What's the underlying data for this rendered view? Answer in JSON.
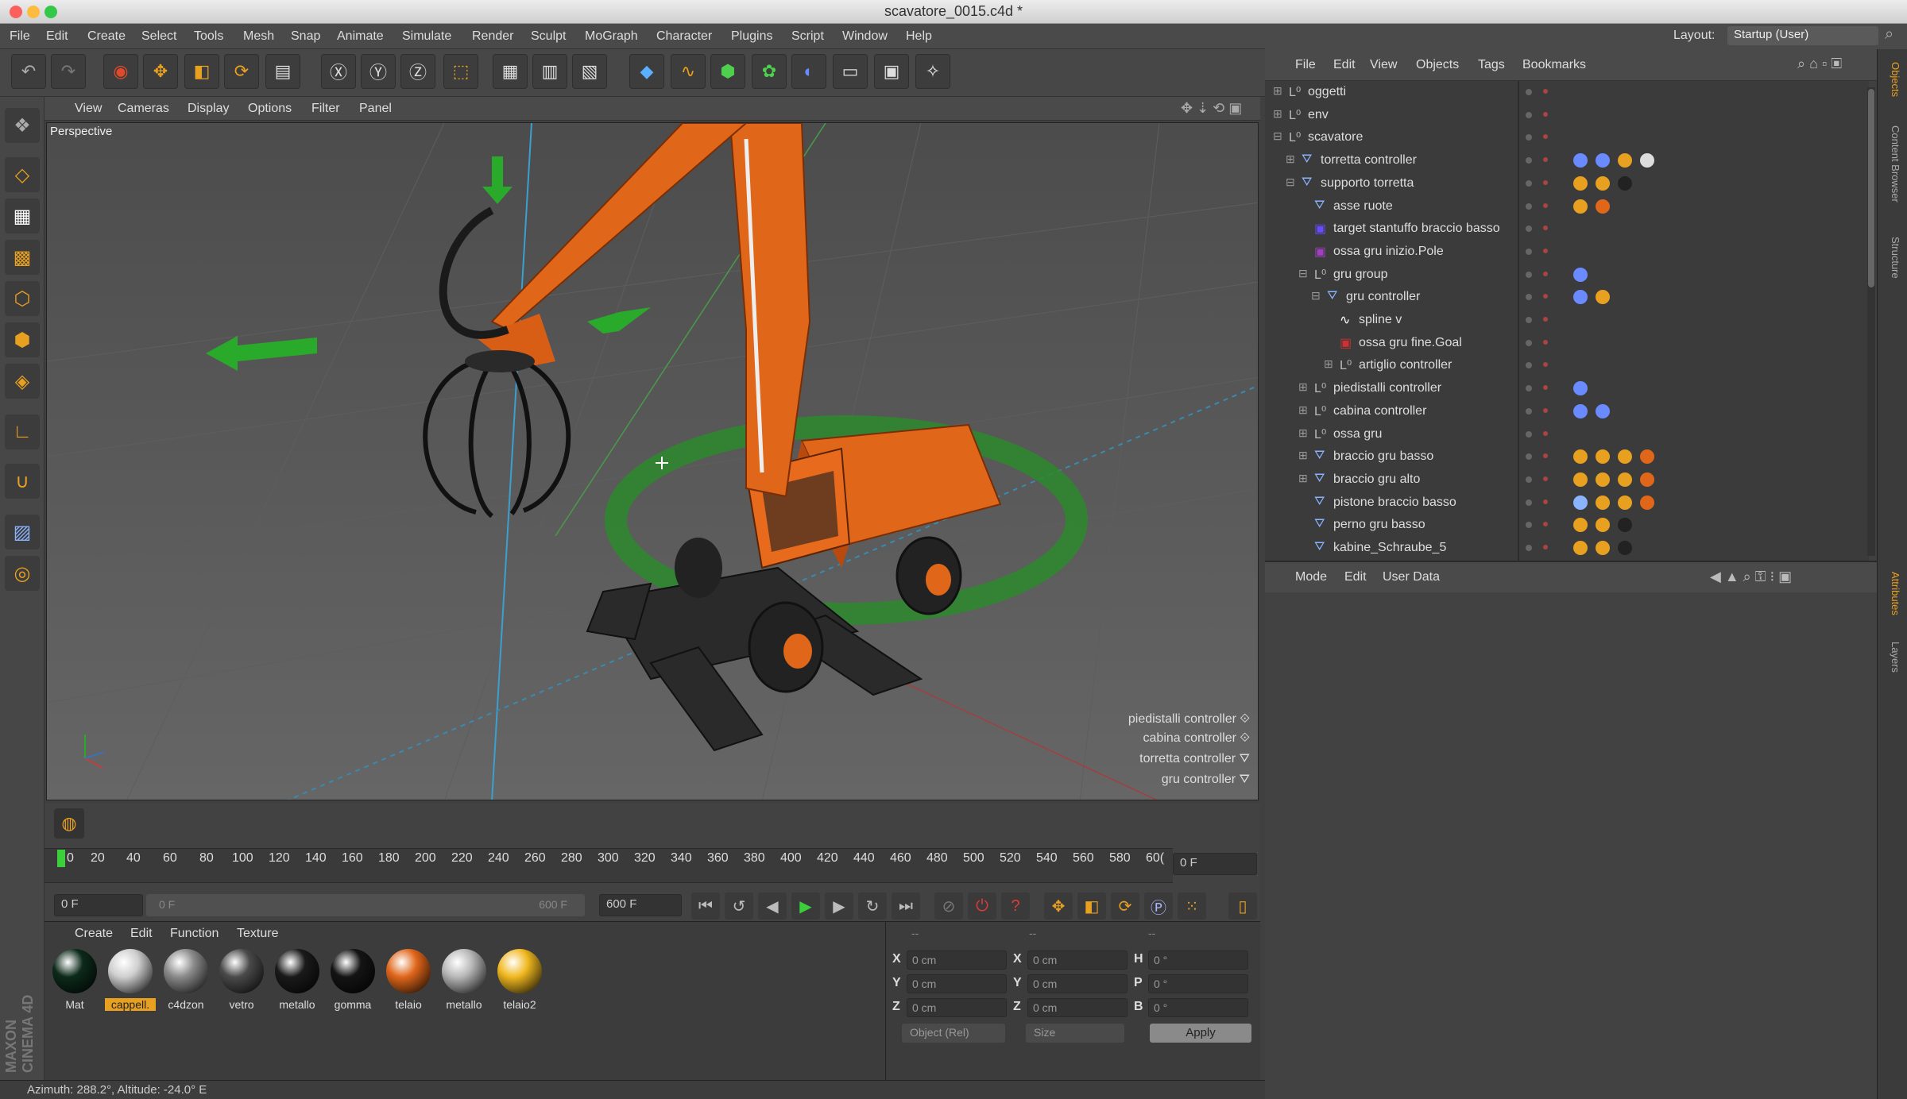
{
  "window": {
    "title": "scavatore_0015.c4d *"
  },
  "menu": [
    "File",
    "Edit",
    "Create",
    "Select",
    "Tools",
    "Mesh",
    "Snap",
    "Animate",
    "Simulate",
    "Render",
    "Sculpt",
    "MoGraph",
    "Character",
    "Plugins",
    "Script",
    "Window",
    "Help"
  ],
  "layout": {
    "label": "Layout:",
    "value": "Startup (User)"
  },
  "viewport_menu": [
    "View",
    "Cameras",
    "Display",
    "Options",
    "Filter",
    "Panel"
  ],
  "viewport": {
    "name": "Perspective",
    "hud": [
      "piedistalli controller",
      "cabina controller",
      "torretta controller",
      "gru controller"
    ]
  },
  "timeline": {
    "ticks": [
      "0",
      "20",
      "40",
      "60",
      "80",
      "100",
      "120",
      "140",
      "160",
      "180",
      "200",
      "220",
      "240",
      "260",
      "280",
      "300",
      "320",
      "340",
      "360",
      "380",
      "400",
      "420",
      "440",
      "460",
      "480",
      "500",
      "520",
      "540",
      "560",
      "580",
      "60("
    ],
    "current_frame": "0 F",
    "start_field": "0 F",
    "slider_start": "0 F",
    "slider_end": "600 F",
    "end_field": "600 F"
  },
  "materials": {
    "menu": [
      "Create",
      "Edit",
      "Function",
      "Texture"
    ],
    "items": [
      {
        "name": "Mat",
        "color": "#0c2a1a"
      },
      {
        "name": "cappell.",
        "color": "#cfcfcf",
        "selected": true
      },
      {
        "name": "c4dzon",
        "color": "#8a8a8a"
      },
      {
        "name": "vetro",
        "color": "#4a4a4a"
      },
      {
        "name": "metallo",
        "color": "#1a1a1a"
      },
      {
        "name": "gomma",
        "color": "#141414"
      },
      {
        "name": "telaio",
        "color": "#e0661a"
      },
      {
        "name": "metallo",
        "color": "#b8b8b8"
      },
      {
        "name": "telaio2",
        "color": "#f0b820"
      }
    ],
    "brand": "MAXON CINEMA 4D"
  },
  "coords": {
    "headers": [
      "--",
      "--",
      "--"
    ],
    "rows": [
      {
        "a": "X",
        "av": "0 cm",
        "b": "X",
        "bv": "0 cm",
        "c": "H",
        "cv": "0 °"
      },
      {
        "a": "Y",
        "av": "0 cm",
        "b": "Y",
        "bv": "0 cm",
        "c": "P",
        "cv": "0 °"
      },
      {
        "a": "Z",
        "av": "0 cm",
        "b": "Z",
        "bv": "0 cm",
        "c": "B",
        "cv": "0 °"
      }
    ],
    "mode": "Object (Rel)",
    "size": "Size",
    "apply": "Apply"
  },
  "status": "Azimuth: 288.2°, Altitude: -24.0° E",
  "objmgr": {
    "menu": [
      "File",
      "Edit",
      "View",
      "Objects",
      "Tags",
      "Bookmarks"
    ],
    "rows": [
      {
        "name": "oggetti",
        "depth": 0,
        "icon": "null",
        "exp": "+"
      },
      {
        "name": "env",
        "depth": 0,
        "icon": "null",
        "exp": "+"
      },
      {
        "name": "scavatore",
        "depth": 0,
        "icon": "null",
        "exp": "-"
      },
      {
        "name": "torretta controller",
        "depth": 1,
        "icon": "joint",
        "exp": "+"
      },
      {
        "name": "supporto torretta",
        "depth": 1,
        "icon": "joint",
        "exp": "-"
      },
      {
        "name": "asse ruote",
        "depth": 2,
        "icon": "joint",
        "exp": ""
      },
      {
        "name": "target stantuffo braccio basso",
        "depth": 2,
        "icon": "target",
        "exp": ""
      },
      {
        "name": "ossa gru inizio.Pole",
        "depth": 2,
        "icon": "pole",
        "exp": ""
      },
      {
        "name": "gru group",
        "depth": 2,
        "icon": "null",
        "exp": "-"
      },
      {
        "name": "gru controller",
        "depth": 3,
        "icon": "joint",
        "exp": "-"
      },
      {
        "name": "spline v",
        "depth": 4,
        "icon": "spline",
        "exp": ""
      },
      {
        "name": "ossa gru fine.Goal",
        "depth": 4,
        "icon": "goal",
        "exp": ""
      },
      {
        "name": "artiglio controller",
        "depth": 4,
        "icon": "null",
        "exp": "+"
      },
      {
        "name": "piedistalli controller",
        "depth": 2,
        "icon": "null",
        "exp": "+"
      },
      {
        "name": "cabina controller",
        "depth": 2,
        "icon": "null",
        "exp": "+"
      },
      {
        "name": "ossa gru",
        "depth": 2,
        "icon": "null",
        "exp": "+"
      },
      {
        "name": "braccio gru basso",
        "depth": 2,
        "icon": "joint",
        "exp": "+"
      },
      {
        "name": "braccio gru alto",
        "depth": 2,
        "icon": "joint",
        "exp": "+"
      },
      {
        "name": "pistone braccio basso",
        "depth": 2,
        "icon": "joint",
        "exp": ""
      },
      {
        "name": "perno gru basso",
        "depth": 2,
        "icon": "joint",
        "exp": ""
      },
      {
        "name": "kabine_Schraube_5",
        "depth": 2,
        "icon": "joint",
        "exp": ""
      }
    ]
  },
  "attributes": {
    "menu": [
      "Mode",
      "Edit",
      "User Data"
    ]
  },
  "right_tabs": [
    "Objects",
    "Content Browser",
    "Structure",
    "Attributes",
    "Layers"
  ]
}
